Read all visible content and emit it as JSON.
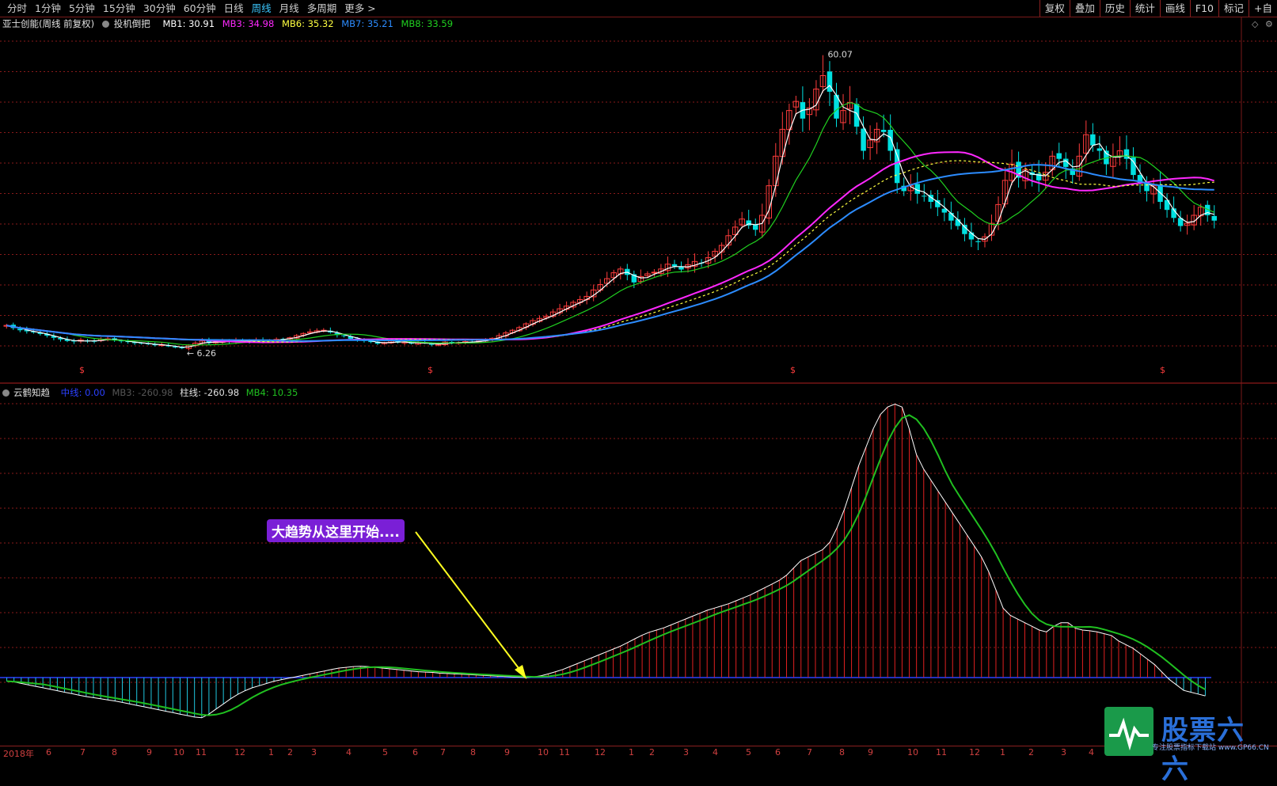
{
  "toolbar": {
    "periods": [
      "分时",
      "1分钟",
      "5分钟",
      "15分钟",
      "30分钟",
      "60分钟",
      "日线",
      "周线",
      "月线",
      "多周期",
      "更多 >"
    ],
    "active_period": "周线",
    "buttons": [
      "复权",
      "叠加",
      "历史",
      "统计",
      "画线",
      "F10",
      "标记",
      "+自"
    ]
  },
  "info": {
    "stock": "亚士创能(周线 前复权)",
    "indicator": "投机倒把",
    "mb1": "MB1: 30.91",
    "mb3": "MB3: 34.98",
    "mb6": "MB6: 35.32",
    "mb7": "MB7: 35.21",
    "mb8": "MB8: 33.59"
  },
  "indicator_panel": {
    "name": "云鹤知趋",
    "zhongxian": "中线: 0.00",
    "mb3": "MB3: -260.98",
    "zhuxian": "柱线: -260.98",
    "mb4": "MB4: 10.35"
  },
  "annotation": "大趋势从这里开始....",
  "colors": {
    "up": "#ff3c3c",
    "down": "#00e0e0",
    "ma_short": "#ffffff",
    "ma_green": "#20d020",
    "ma_magenta": "#ff28ff",
    "ma_yellow": "#ffff40",
    "ma_blue": "#2c8cff",
    "grid": "#8a1a1a",
    "arrow": "#ffff20"
  },
  "logo": {
    "title": "股票六六",
    "subtitle": "专注股票指标下载站 www.GP66.CN"
  },
  "chart_data": [
    {
      "type": "candlestick",
      "title": "亚士创能(周线 前复权)",
      "y_annotations": [
        {
          "label": "60.07",
          "value": 60.07
        },
        {
          "label": "6.26",
          "value": 6.26
        }
      ],
      "ylim": [
        3,
        64
      ],
      "closes": [
        10.5,
        10.0,
        9.6,
        9.4,
        9.2,
        8.9,
        8.6,
        8.2,
        7.9,
        7.6,
        7.5,
        7.8,
        7.5,
        7.6,
        7.9,
        8.0,
        7.7,
        7.6,
        7.4,
        7.2,
        7.2,
        7.0,
        6.8,
        6.9,
        6.6,
        6.4,
        6.3,
        6.8,
        7.2,
        7.6,
        7.2,
        7.4,
        7.6,
        7.5,
        7.7,
        7.6,
        7.5,
        7.8,
        7.6,
        7.7,
        7.9,
        8.0,
        8.2,
        8.6,
        9.0,
        9.3,
        9.5,
        9.6,
        9.2,
        8.7,
        8.6,
        8.0,
        7.9,
        7.6,
        7.4,
        7.1,
        7.3,
        7.6,
        7.3,
        7.4,
        7.1,
        7.3,
        7.2,
        6.9,
        7.0,
        7.4,
        7.2,
        7.3,
        7.5,
        7.4,
        7.6,
        7.9,
        8.1,
        8.6,
        9.1,
        9.6,
        10.1,
        10.8,
        11.4,
        11.8,
        12.2,
        13.0,
        13.6,
        14.1,
        14.8,
        15.3,
        15.9,
        17.1,
        18.1,
        19.2,
        20.3,
        21.0,
        19.9,
        18.5,
        19.6,
        20.1,
        20.4,
        21.0,
        21.9,
        21.5,
        20.9,
        21.8,
        22.4,
        22.1,
        23.1,
        24.3,
        25.4,
        27.2,
        28.8,
        30.3,
        29.1,
        28.3,
        31.0,
        36.5,
        42.0,
        47.0,
        50.5,
        52.2,
        49.0,
        51.0,
        54.5,
        57.0,
        54.0,
        49.0,
        50.5,
        52.0,
        47.5,
        43.0,
        45.0,
        47.0,
        46.5,
        43.0,
        37.0,
        35.5,
        36.5,
        35.0,
        34.5,
        33.5,
        32.5,
        31.5,
        30.0,
        29.0,
        27.5,
        26.5,
        26.0,
        27.0,
        29.5,
        33.0,
        37.5,
        40.5,
        38.0,
        39.5,
        38.5,
        37.5,
        39.0,
        42.0,
        41.5,
        40.0,
        38.5,
        42.0,
        46.0,
        44.0,
        43.0,
        40.5,
        42.0,
        43.0,
        41.5,
        38.5,
        37.0,
        35.5,
        36.5,
        33.5,
        32.0,
        30.5,
        29.0,
        29.5,
        31.0,
        32.5,
        31.0,
        30.0
      ]
    },
    {
      "type": "bar",
      "title": "云鹤知趋",
      "ylim": [
        -120,
        760
      ],
      "note": "histogram (柱线) with white line and green MB4 line; positive red, negative cyan",
      "values": [
        -10,
        -12,
        -16,
        -20,
        -24,
        -28,
        -32,
        -36,
        -40,
        -44,
        -48,
        -52,
        -55,
        -58,
        -61,
        -64,
        -68,
        -72,
        -76,
        -80,
        -84,
        -88,
        -92,
        -96,
        -100,
        -104,
        -108,
        -110,
        -100,
        -86,
        -72,
        -58,
        -46,
        -36,
        -28,
        -22,
        -16,
        -10,
        -6,
        -2,
        2,
        6,
        10,
        14,
        18,
        22,
        26,
        28,
        30,
        31,
        30,
        28,
        26,
        24,
        22,
        20,
        18,
        16,
        15,
        14,
        12,
        11,
        10,
        9,
        8,
        7,
        6,
        5,
        4,
        3,
        2,
        1,
        0,
        2,
        5,
        10,
        16,
        22,
        30,
        38,
        46,
        54,
        62,
        70,
        78,
        86,
        96,
        106,
        116,
        124,
        130,
        136,
        144,
        152,
        160,
        168,
        176,
        184,
        190,
        196,
        202,
        210,
        218,
        226,
        236,
        246,
        256,
        266,
        280,
        300,
        320,
        330,
        340,
        350,
        370,
        410,
        460,
        520,
        580,
        630,
        680,
        720,
        740,
        748,
        740,
        680,
        610,
        570,
        540,
        510,
        480,
        450,
        420,
        390,
        360,
        330,
        290,
        240,
        190,
        170,
        160,
        150,
        140,
        130,
        125,
        140,
        150,
        150,
        135,
        130,
        128,
        125,
        120,
        115,
        100,
        90,
        80,
        65,
        50,
        35,
        15,
        -5,
        -20,
        -35,
        -40,
        -45,
        -50
      ]
    }
  ]
}
